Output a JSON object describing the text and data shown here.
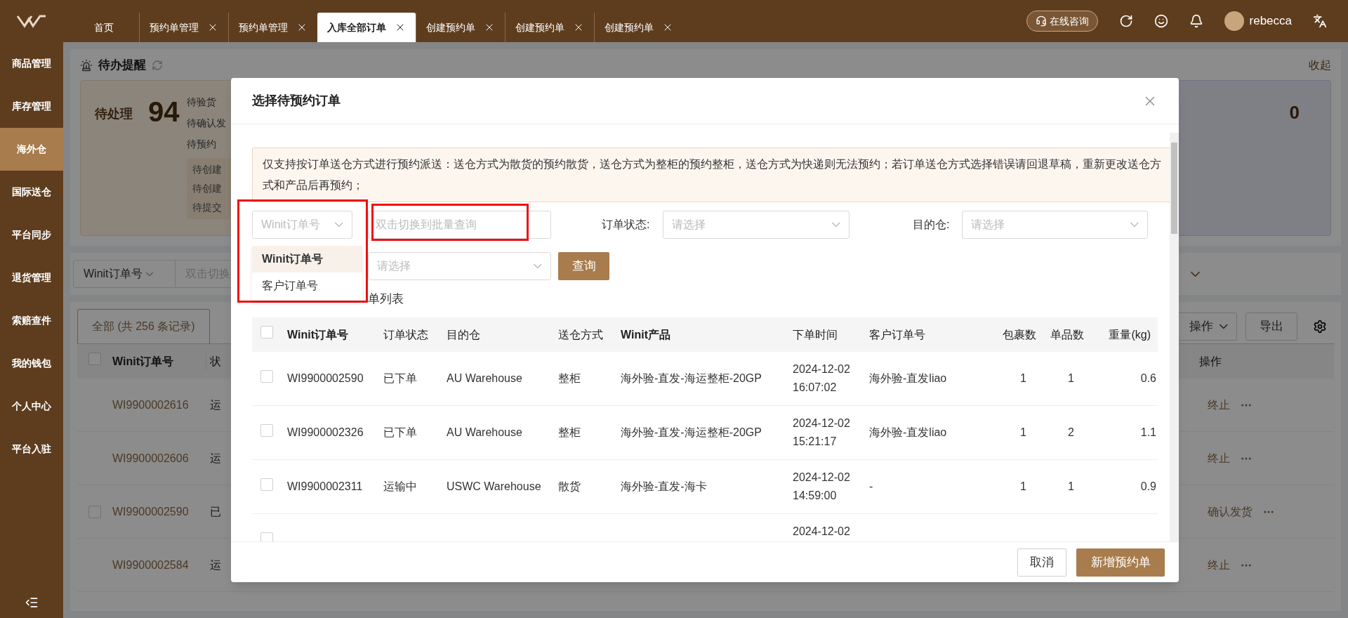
{
  "tabs": [
    {
      "label": "首页",
      "selected": false,
      "closable": false
    },
    {
      "label": "预约单管理",
      "selected": false,
      "closable": true
    },
    {
      "label": "预约单管理",
      "selected": false,
      "closable": true
    },
    {
      "label": "入库全部订单",
      "selected": true,
      "closable": true
    },
    {
      "label": "创建预约单",
      "selected": false,
      "closable": true
    },
    {
      "label": "创建预约单",
      "selected": false,
      "closable": true
    },
    {
      "label": "创建预约单",
      "selected": false,
      "closable": true
    }
  ],
  "header": {
    "consult": "在线咨询",
    "user": "rebecca"
  },
  "sidebar": [
    {
      "label": "商品管理",
      "selected": false
    },
    {
      "label": "库存管理",
      "selected": false
    },
    {
      "label": "海外仓",
      "selected": true
    },
    {
      "label": "国际送仓",
      "selected": false
    },
    {
      "label": "平台同步",
      "selected": false
    },
    {
      "label": "退货管理",
      "selected": false
    },
    {
      "label": "索赔查件",
      "selected": false
    },
    {
      "label": "我的钱包",
      "selected": false
    },
    {
      "label": "个人中心",
      "selected": false
    },
    {
      "label": "平台入驻",
      "selected": false
    }
  ],
  "todo": {
    "title": "待办提醒",
    "pending_label": "待处理",
    "pending_count": "94",
    "items": [
      "待验货",
      "待确认发",
      "待预约"
    ],
    "sub_items": [
      "待创建",
      "待创建",
      "待提交"
    ],
    "collapse": "收起",
    "right_count": "0"
  },
  "filter": {
    "type": "Winit订单号",
    "placeholder": "双击切换"
  },
  "list_tabs": [
    {
      "label": "全部 (共 256 条记录)",
      "selected": true
    }
  ],
  "toolbar": {
    "batch": "操作",
    "export": "导出"
  },
  "bg_table": {
    "all_checked": false,
    "columns": [
      "Winit订单号",
      "状"
    ],
    "action_header": "操作",
    "rows": [
      {
        "order": "WI9900002616",
        "status": "运",
        "selectable": false,
        "action": "终止"
      },
      {
        "order": "WI9900002606",
        "status": "运",
        "selectable": false,
        "action": "终止"
      },
      {
        "order": "WI9900002590",
        "status": "已",
        "selectable": true,
        "checked": false,
        "action": "确认发货"
      },
      {
        "order": "WI9900002584",
        "status": "运",
        "selectable": false,
        "action": "终止"
      }
    ]
  },
  "modal": {
    "title": "选择待预约订单",
    "notice": "仅支持按订单送仓方式进行预约派送：送仓方式为散货的预约散货，送仓方式为整柜的预约整柜，送仓方式为快递则无法预约；若订单送仓方式选择错误请回退草稿，重新更改送仓方式和产品后再预约；",
    "type_select": {
      "placeholder": "Winit订单号",
      "open": true,
      "highlighted": true,
      "options": [
        {
          "label": "Winit订单号",
          "selected": true
        },
        {
          "label": "客户订单号",
          "selected": false
        }
      ]
    },
    "batch_input": {
      "placeholder": "双击切换到批量查询",
      "highlighted": true
    },
    "status_filter": {
      "label": "订单状态:",
      "placeholder": "请选择"
    },
    "warehouse_filter": {
      "label": "目的仓:",
      "placeholder": "请选择"
    },
    "product_filter": {
      "placeholder": "请选择"
    },
    "query": "查询",
    "list_label": "单列表",
    "all_checked": false,
    "columns": [
      "Winit订单号",
      "订单状态",
      "目的仓",
      "送仓方式",
      "Winit产品",
      "下单时间",
      "客户订单号",
      "包裹数",
      "单品数",
      "重量(kg)"
    ],
    "rows": [
      {
        "checked": false,
        "order": "WI9900002590",
        "status": "已下单",
        "warehouse": "AU Warehouse",
        "method": "整柜",
        "product": "海外验-直发-海运整柜-20GP",
        "date": "2024-12-02",
        "time": "16:07:02",
        "customer": "海外验-直发liao",
        "packages": "1",
        "items": "1",
        "weight": "0.6"
      },
      {
        "checked": false,
        "order": "WI9900002326",
        "status": "已下单",
        "warehouse": "AU Warehouse",
        "method": "整柜",
        "product": "海外验-直发-海运整柜-20GP",
        "date": "2024-12-02",
        "time": "15:21:17",
        "customer": "海外验-直发liao",
        "packages": "1",
        "items": "2",
        "weight": "1.1"
      },
      {
        "checked": false,
        "order": "WI9900002311",
        "status": "运输中",
        "warehouse": "USWC Warehouse",
        "method": "散货",
        "product": "海外验-直发-海卡",
        "date": "2024-12-02",
        "time": "14:59:00",
        "customer": "-",
        "packages": "1",
        "items": "1",
        "weight": "0.9"
      },
      {
        "checked": false,
        "date": "2024-12-02"
      }
    ],
    "cancel": "取消",
    "submit": "新增预约单"
  }
}
